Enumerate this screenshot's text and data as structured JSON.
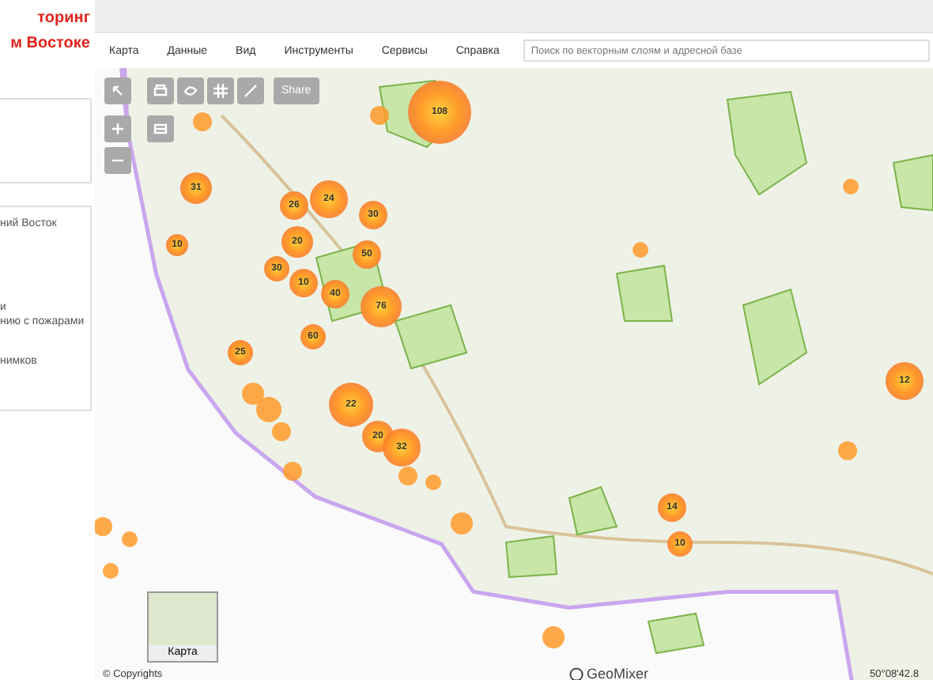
{
  "header": {
    "title_lines": [
      "торинг",
      "м Востоке"
    ]
  },
  "menu": {
    "items": [
      "Карта",
      "Данные",
      "Вид",
      "Инструменты",
      "Сервисы",
      "Справка"
    ],
    "search": {
      "placeholder": "Поиск по векторным слоям и адресной базе"
    }
  },
  "sidebar": {
    "lines": [
      "ний Восток",
      "и",
      "нию с пожарами",
      "нимков"
    ]
  },
  "map_toolbar": {
    "share": "Share"
  },
  "clusters": [
    {
      "label": "108"
    },
    {
      "label": "31"
    },
    {
      "label": "24"
    },
    {
      "label": "26"
    },
    {
      "label": "20"
    },
    {
      "label": "30"
    },
    {
      "label": "50"
    },
    {
      "label": "76"
    },
    {
      "label": "40"
    },
    {
      "label": "10"
    },
    {
      "label": "30"
    },
    {
      "label": "60"
    },
    {
      "label": "25"
    },
    {
      "label": "22"
    },
    {
      "label": "20"
    },
    {
      "label": "32"
    },
    {
      "label": "12"
    },
    {
      "label": "14"
    },
    {
      "label": "10"
    },
    {
      "label": "10"
    }
  ],
  "minimap": {
    "label": "Карта"
  },
  "footer": {
    "copyright": "© Copyrights",
    "brand": "GeoMixer",
    "coordinates": "50°08'42.8"
  }
}
